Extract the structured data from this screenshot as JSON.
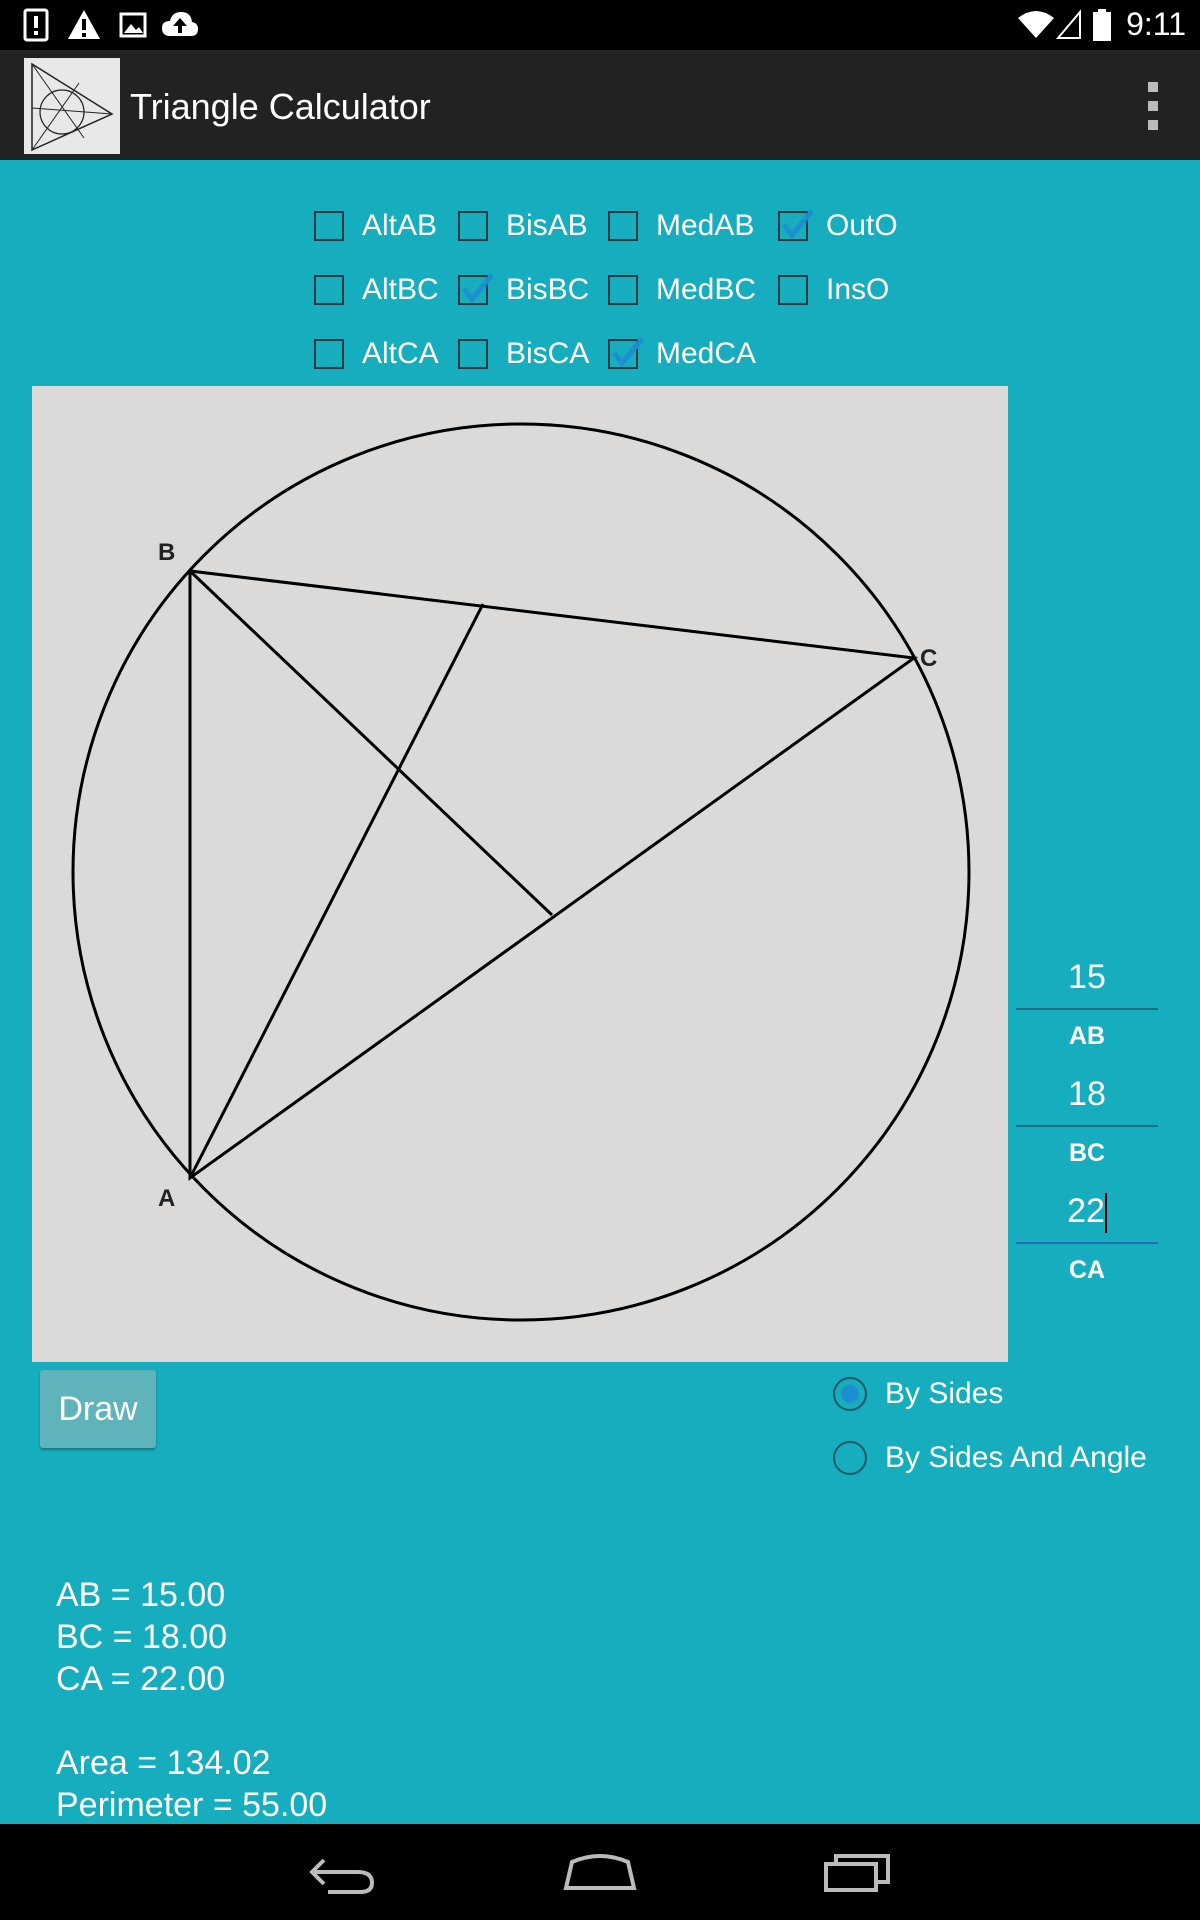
{
  "status_bar": {
    "time": "9:11",
    "icons": [
      "alert-icon",
      "warning-icon",
      "image-icon",
      "cloud-upload-icon",
      "wifi-icon",
      "signal-icon",
      "battery-icon"
    ]
  },
  "action_bar": {
    "title": "Triangle Calculator",
    "overflow_icon": "overflow-menu-icon"
  },
  "checkboxes": [
    {
      "id": "altab",
      "label": "AltAB",
      "checked": false
    },
    {
      "id": "bisab",
      "label": "BisAB",
      "checked": false
    },
    {
      "id": "medab",
      "label": "MedAB",
      "checked": false
    },
    {
      "id": "outo",
      "label": "OutO",
      "checked": true
    },
    {
      "id": "altbc",
      "label": "AltBC",
      "checked": false
    },
    {
      "id": "bisbc",
      "label": "BisBC",
      "checked": true
    },
    {
      "id": "medbc",
      "label": "MedBC",
      "checked": false
    },
    {
      "id": "inso",
      "label": "InsO",
      "checked": false
    },
    {
      "id": "altca",
      "label": "AltCA",
      "checked": false
    },
    {
      "id": "bisca",
      "label": "BisCA",
      "checked": false
    },
    {
      "id": "medca",
      "label": "MedCA",
      "checked": true
    }
  ],
  "triangle": {
    "vertex_labels": {
      "a": "A",
      "b": "B",
      "c": "C"
    }
  },
  "inputs": {
    "ab": {
      "value": "15",
      "label": "AB"
    },
    "bc": {
      "value": "18",
      "label": "BC"
    },
    "ca": {
      "value": "22",
      "label": "CA"
    }
  },
  "draw_button": {
    "label": "Draw"
  },
  "mode": {
    "options": [
      {
        "label": "By Sides",
        "checked": true
      },
      {
        "label": "By Sides And Angle",
        "checked": false
      }
    ]
  },
  "results": {
    "ab": "AB = 15.00",
    "bc": "BC = 18.00",
    "ca": "CA = 22.00",
    "area": "Area = 134.02",
    "perimeter": "Perimeter = 55.00"
  },
  "nav_bar": {
    "icons": [
      "back-icon",
      "home-icon",
      "recents-icon"
    ]
  }
}
